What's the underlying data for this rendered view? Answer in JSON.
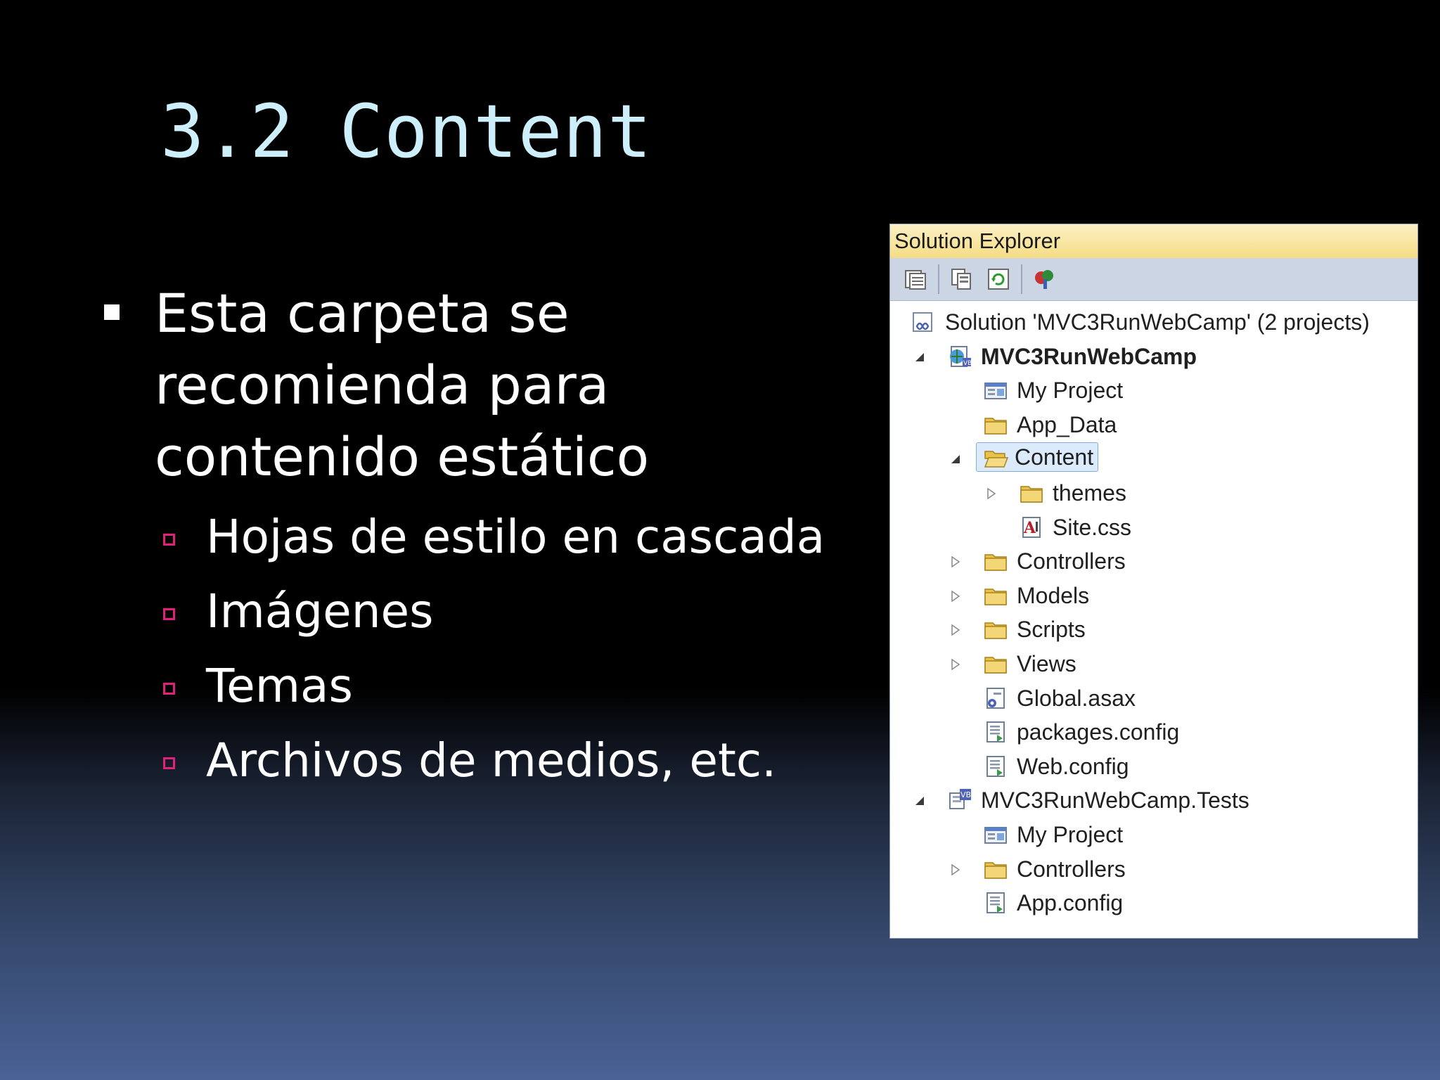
{
  "slide": {
    "title": "3.2 Content",
    "bullet": "Esta carpeta se recomienda para contenido estático",
    "subitems": [
      "Hojas de estilo en cascada",
      "Imágenes",
      "Temas",
      "Archivos de medios, etc."
    ]
  },
  "solution_explorer": {
    "title": "Solution Explorer",
    "toolbar": [
      "properties-icon",
      "show-all-files-icon",
      "refresh-icon",
      "class-diagram-icon"
    ],
    "tree": [
      {
        "label": "Solution 'MVC3RunWebCamp' (2 projects)",
        "icon": "solution-icon",
        "arrow": "none"
      },
      {
        "label": "MVC3RunWebCamp",
        "icon": "web-project-icon",
        "arrow": "expanded",
        "bold": true
      },
      {
        "label": "My Project",
        "icon": "my-project-icon",
        "arrow": "none"
      },
      {
        "label": "App_Data",
        "icon": "folder-icon",
        "arrow": "none"
      },
      {
        "label": "Content",
        "icon": "open-folder-icon",
        "arrow": "expanded",
        "selected": true
      },
      {
        "label": "themes",
        "icon": "folder-icon",
        "arrow": "collapsed"
      },
      {
        "label": "Site.css",
        "icon": "css-file-icon",
        "arrow": "none"
      },
      {
        "label": "Controllers",
        "icon": "folder-icon",
        "arrow": "collapsed"
      },
      {
        "label": "Models",
        "icon": "folder-icon",
        "arrow": "collapsed"
      },
      {
        "label": "Scripts",
        "icon": "folder-icon",
        "arrow": "collapsed"
      },
      {
        "label": "Views",
        "icon": "folder-icon",
        "arrow": "collapsed"
      },
      {
        "label": "Global.asax",
        "icon": "asax-file-icon",
        "arrow": "none"
      },
      {
        "label": "packages.config",
        "icon": "config-file-icon",
        "arrow": "none"
      },
      {
        "label": "Web.config",
        "icon": "config-file-icon",
        "arrow": "none"
      },
      {
        "label": "MVC3RunWebCamp.Tests",
        "icon": "vb-project-icon",
        "arrow": "expanded"
      },
      {
        "label": "My Project",
        "icon": "my-project-icon",
        "arrow": "none"
      },
      {
        "label": "Controllers",
        "icon": "folder-icon",
        "arrow": "collapsed"
      },
      {
        "label": "App.config",
        "icon": "config-file-icon",
        "arrow": "none"
      }
    ]
  }
}
